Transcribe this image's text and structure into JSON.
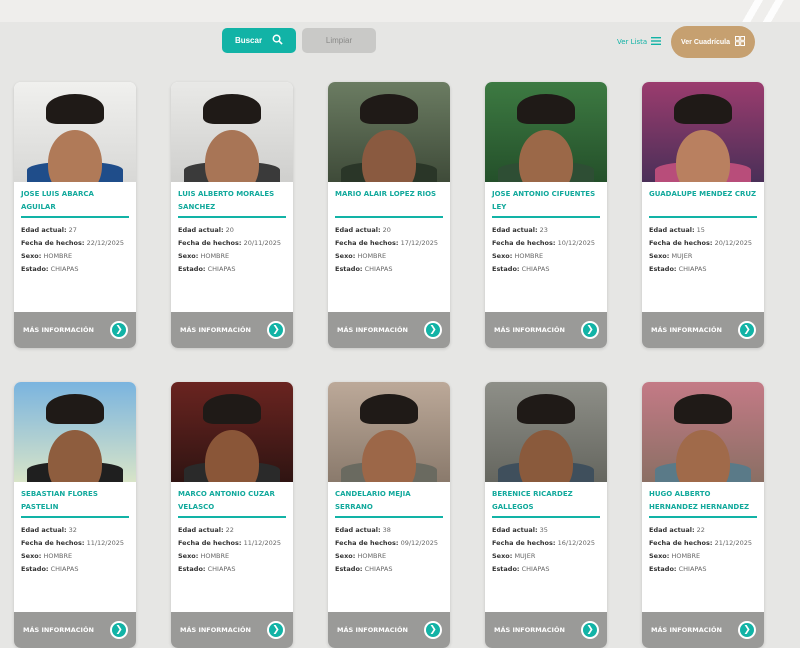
{
  "toolbar": {
    "search_label": "Buscar",
    "clear_label": "Limpiar",
    "list_label": "Ver Lista",
    "grid_label": "Ver Cuadrícula"
  },
  "labels": {
    "age": "Edad actual:",
    "date": "Fecha de hechos:",
    "sex": "Sexo:",
    "state": "Estado:",
    "more": "MÁS INFORMACIÓN"
  },
  "cards": [
    {
      "name": "JOSE LUIS ABARCA AGUILAR",
      "age": "27",
      "date": "22/12/2025",
      "sex": "HOMBRE",
      "state": "CHIAPAS"
    },
    {
      "name": "LUIS ALBERTO MORALES SANCHEZ",
      "age": "20",
      "date": "20/11/2025",
      "sex": "HOMBRE",
      "state": "CHIAPAS"
    },
    {
      "name": "MARIO ALAIR LOPEZ RIOS",
      "age": "20",
      "date": "17/12/2025",
      "sex": "HOMBRE",
      "state": "CHIAPAS"
    },
    {
      "name": "JOSE ANTONIO CIFUENTES LEY",
      "age": "23",
      "date": "10/12/2025",
      "sex": "HOMBRE",
      "state": "CHIAPAS"
    },
    {
      "name": "GUADALUPE MENDEZ CRUZ",
      "age": "15",
      "date": "20/12/2025",
      "sex": "MUJER",
      "state": "CHIAPAS"
    },
    {
      "name": "SEBASTIAN FLORES PASTELIN",
      "age": "32",
      "date": "11/12/2025",
      "sex": "HOMBRE",
      "state": "CHIAPAS"
    },
    {
      "name": "MARCO ANTONIO CUZAR VELASCO",
      "age": "22",
      "date": "11/12/2025",
      "sex": "HOMBRE",
      "state": "CHIAPAS"
    },
    {
      "name": "CANDELARIO MEJIA SERRANO",
      "age": "38",
      "date": "09/12/2025",
      "sex": "HOMBRE",
      "state": "CHIAPAS"
    },
    {
      "name": "BERENICE RICARDEZ GALLEGOS",
      "age": "35",
      "date": "16/12/2025",
      "sex": "MUJER",
      "state": "CHIAPAS"
    },
    {
      "name": "HUGO ALBERTO HERNANDEZ HERNANDEZ",
      "age": "22",
      "date": "21/12/2025",
      "sex": "HOMBRE",
      "state": "CHIAPAS"
    }
  ],
  "colors": {
    "accent": "#12b3a6",
    "grid_button": "#c6a070",
    "background": "#e6e6e4",
    "footer_bar": "#9a9a98"
  }
}
